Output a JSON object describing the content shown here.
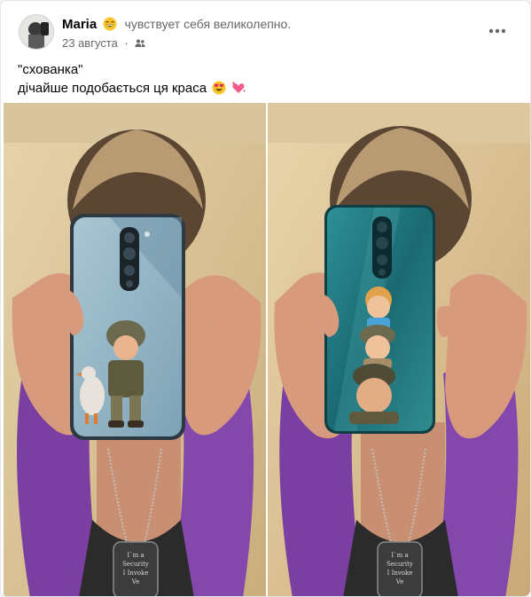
{
  "post": {
    "author": "Maria",
    "feeling": "чувствует себя великолепно.",
    "date": "23 августа",
    "separator": "·",
    "text_line1": "\"схованка\"",
    "text_line2": "дічайше подобається ця краса",
    "feeling_icon": "grinning-emoji-icon",
    "audience_icon": "friends-audience-icon",
    "more_icon": "more-options-icon"
  },
  "photos": [
    {
      "name": "photo-left",
      "tag_text": [
        "I`m a",
        "Security",
        "I Invoke",
        "Ve"
      ]
    },
    {
      "name": "photo-right",
      "tag_text": [
        "I`m a",
        "Security",
        "I Invoke",
        "Ve"
      ]
    }
  ],
  "colors": {
    "background": "#ffffff",
    "text_primary": "#050505",
    "text_secondary": "#65676b",
    "wall": "#d7c39a",
    "purple_scarf": "#7a3fa0",
    "case_left": "#8fb2c4",
    "case_right": "#1f6f78"
  }
}
